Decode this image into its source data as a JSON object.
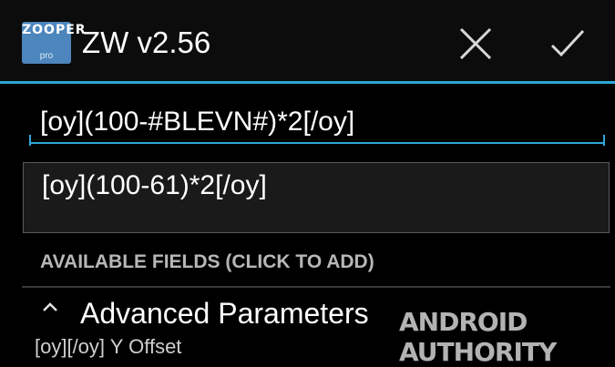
{
  "app_bar": {
    "logo_text": "ZOOPER",
    "logo_sub": "pro",
    "title": "ZW v2.56",
    "cancel_icon": "close-icon",
    "confirm_icon": "check-icon",
    "accent_color": "#2ea7d8",
    "logo_color": "#4c86bd"
  },
  "editor": {
    "formula_value": "[oy](100-#BLEVN#)*2[/oy]",
    "preview_value": "[oy](100-61)*2[/oy]"
  },
  "fields_section": {
    "header": "AVAILABLE FIELDS (CLICK TO ADD)"
  },
  "advanced": {
    "icon": "chevron-up-icon",
    "label": "Advanced Parameters",
    "next_row_text": "[oy][/oy]   Y Offset"
  },
  "watermark": {
    "text": "ANDROID AUTHORITY"
  }
}
